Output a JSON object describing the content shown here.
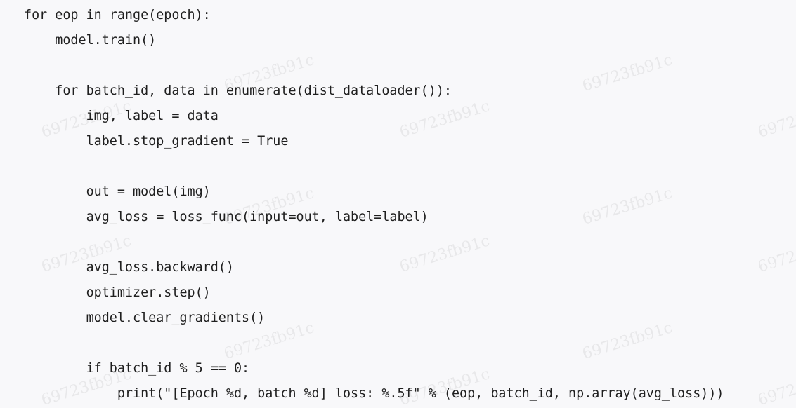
{
  "code": {
    "lines": [
      "for eop in range(epoch):",
      "    model.train()",
      "",
      "    for batch_id, data in enumerate(dist_dataloader()):",
      "        img, label = data",
      "        label.stop_gradient = True",
      "",
      "        out = model(img)",
      "        avg_loss = loss_func(input=out, label=label)",
      "",
      "        avg_loss.backward()",
      "        optimizer.step()",
      "        model.clear_gradients()",
      "",
      "        if batch_id % 5 == 0:",
      "            print(\"[Epoch %d, batch %d] loss: %.5f\" % (eop, batch_id, np.array(avg_loss)))"
    ]
  },
  "watermark": {
    "text": "69723fb91c",
    "color": "#a0a0a0"
  }
}
